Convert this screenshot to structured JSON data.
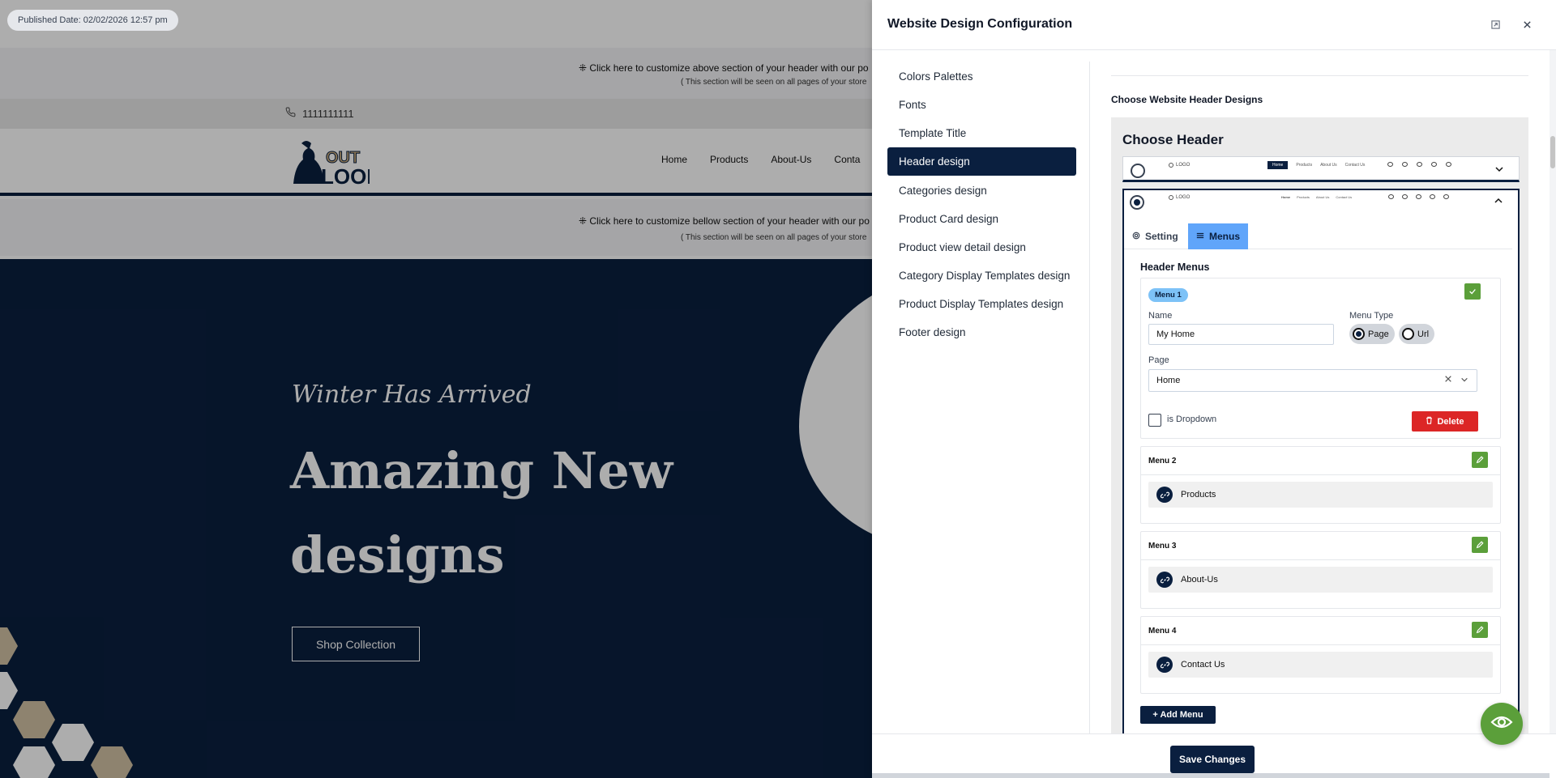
{
  "preview": {
    "published_label": "Published Date: 02/02/2026 12:57 pm",
    "customize_above": "⁜ Click here to customize above section of your header with our po",
    "customize_above_note": "( This section will be seen on all pages of your store",
    "phone": "1111111111",
    "logo_text_top": "OUT",
    "logo_text_bottom": "LOOK",
    "nav_items": [
      "Home",
      "Products",
      "About-Us",
      "Conta"
    ],
    "customize_below": "⁜ Click here to customize bellow section of your header with our po",
    "customize_below_note": "( This section will be seen on all pages of your store",
    "hero_tagline": "Winter Has Arrived",
    "hero_heading": "Amazing New designs",
    "hero_button": "Shop Collection"
  },
  "drawer": {
    "title": "Website Design Configuration",
    "nav": [
      {
        "label": "Colors Palettes",
        "active": false
      },
      {
        "label": "Fonts",
        "active": false
      },
      {
        "label": "Template Title",
        "active": false
      },
      {
        "label": "Header design",
        "active": true
      },
      {
        "label": "Categories design",
        "active": false
      },
      {
        "label": "Product Card design",
        "active": false
      },
      {
        "label": "Product view detail design",
        "active": false
      },
      {
        "label": "Category Display Templates design",
        "active": false
      },
      {
        "label": "Product Display Templates design",
        "active": false
      },
      {
        "label": "Footer design",
        "active": false
      }
    ],
    "section_title": "Choose Website Header Designs",
    "choose_header": "Choose Header",
    "mini_logo": "LOGO",
    "mini_nav": [
      "Home",
      "Products",
      "About Us",
      "Contact Us"
    ],
    "tabs": {
      "setting": "Setting",
      "menus": "Menus"
    },
    "menus_title": "Header Menus",
    "menu1": {
      "badge": "Menu 1",
      "name_label": "Name",
      "name_value": "My Home",
      "type_label": "Menu Type",
      "type_page": "Page",
      "type_url": "Url",
      "page_label": "Page",
      "page_value": "Home",
      "dropdown_label": "is Dropdown",
      "delete_label": "Delete"
    },
    "menus": [
      {
        "title": "Menu 2",
        "item": "Products"
      },
      {
        "title": "Menu 3",
        "item": "About-Us"
      },
      {
        "title": "Menu 4",
        "item": "Contact Us"
      }
    ],
    "add_menu": "+ Add Menu",
    "save": "Save Changes"
  },
  "colors": {
    "navy": "#0a1f3f",
    "green": "#5b9f3a",
    "red": "#dc2626",
    "tab_blue": "#60a5fa"
  }
}
